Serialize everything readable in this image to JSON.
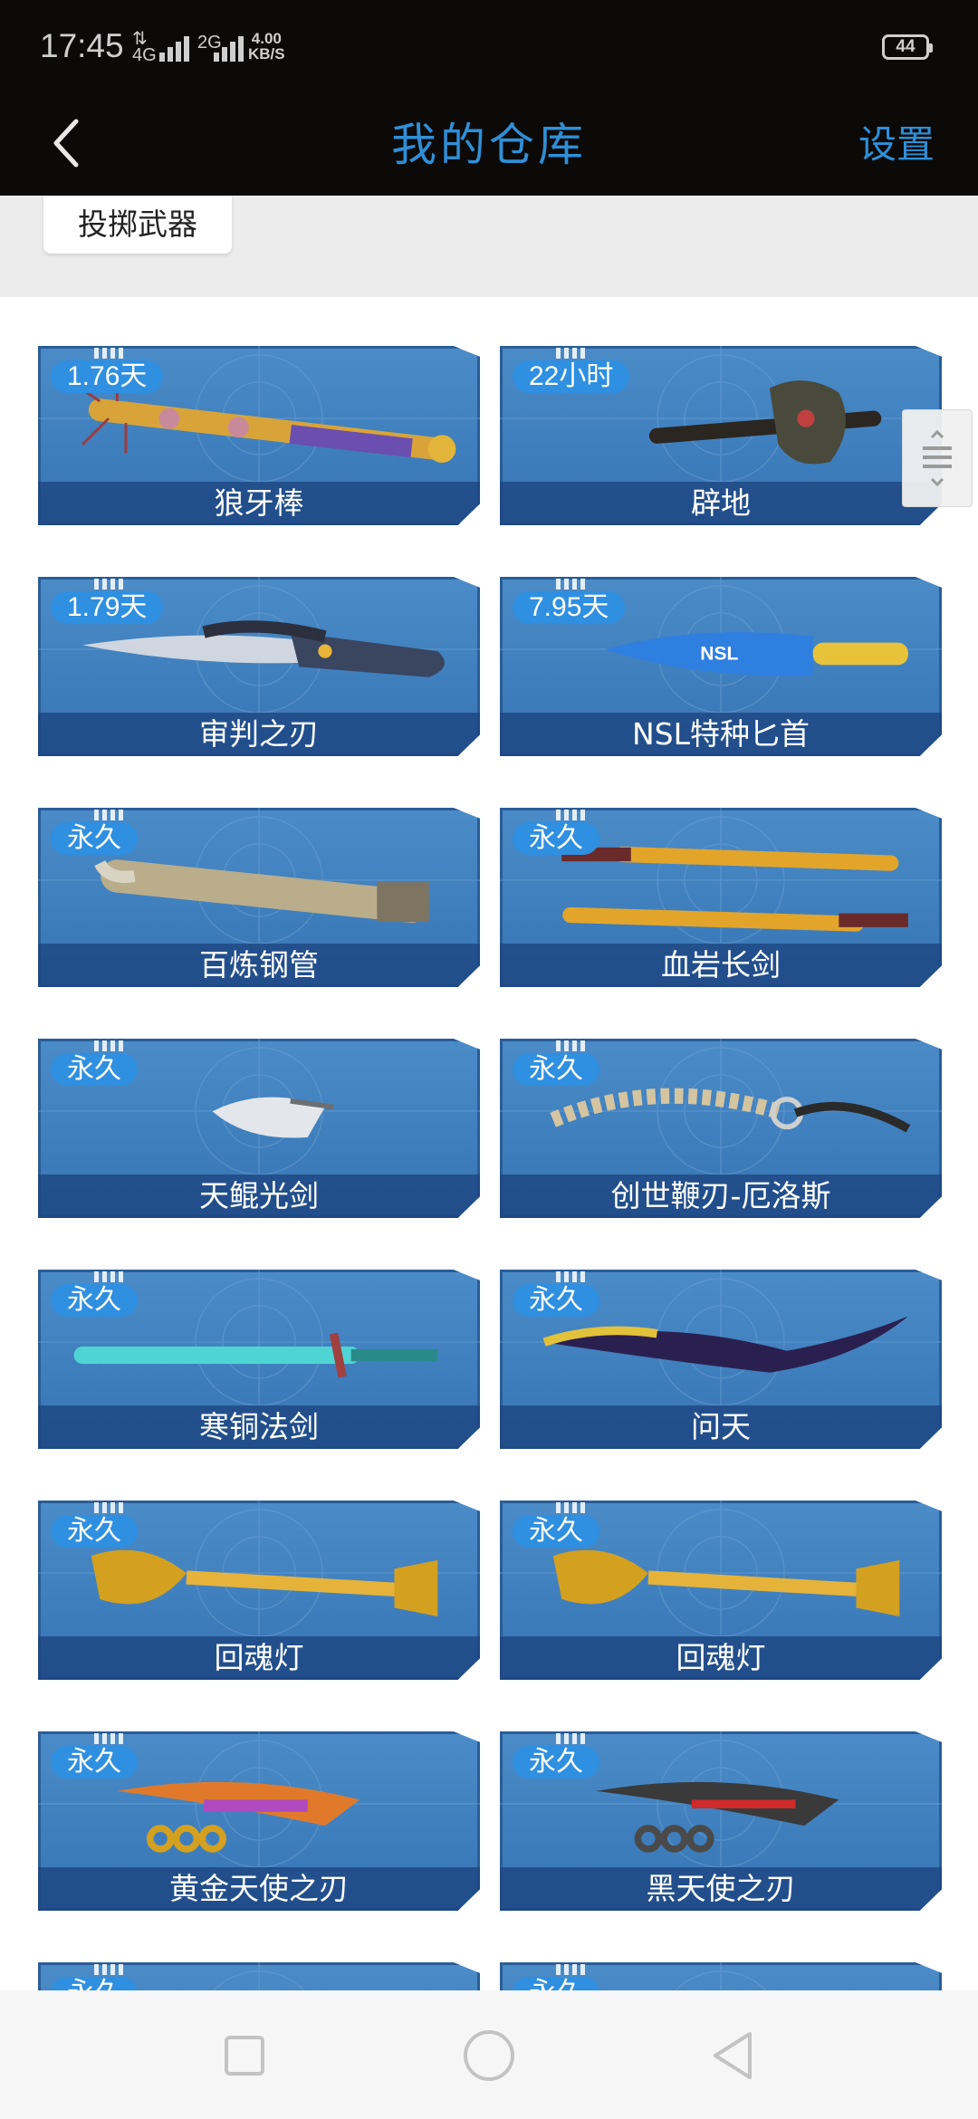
{
  "status_bar": {
    "time": "17:45",
    "net1": "4G",
    "net2": "2G",
    "speed_value": "4.00",
    "speed_unit": "KB/S",
    "battery": "44"
  },
  "header": {
    "title": "我的仓库",
    "settings_label": "设置",
    "back_icon": "chevron-left-icon"
  },
  "filter": {
    "chip_label": "投掷武器"
  },
  "colors": {
    "accent": "#2f8fd8",
    "card": "#3f7fbd",
    "badge": "#2f8fe0"
  },
  "items": [
    {
      "name": "狼牙棒",
      "duration": "1.76天",
      "icon": "spiked-bat-icon"
    },
    {
      "name": "辟地",
      "duration": "22小时",
      "icon": "stone-axe-icon"
    },
    {
      "name": "审判之刃",
      "duration": "1.79天",
      "icon": "curved-blade-icon"
    },
    {
      "name": "NSL特种匕首",
      "duration": "7.95天",
      "icon": "blue-knife-icon"
    },
    {
      "name": "百炼钢管",
      "duration": "永久",
      "icon": "steel-pipe-icon"
    },
    {
      "name": "血岩长剑",
      "duration": "永久",
      "icon": "katana-pair-icon"
    },
    {
      "name": "天鲲光剑",
      "duration": "永久",
      "icon": "light-sword-icon"
    },
    {
      "name": "创世鞭刃-厄洛斯",
      "duration": "永久",
      "icon": "whip-blade-icon"
    },
    {
      "name": "寒铜法剑",
      "duration": "永久",
      "icon": "chain-sword-icon"
    },
    {
      "name": "问天",
      "duration": "永久",
      "icon": "scythe-blade-icon"
    },
    {
      "name": "回魂灯",
      "duration": "永久",
      "icon": "golden-lamp-icon"
    },
    {
      "name": "回魂灯",
      "duration": "永久",
      "icon": "golden-lamp-icon"
    },
    {
      "name": "黄金天使之刃",
      "duration": "永久",
      "icon": "knuckle-blade-gold-icon"
    },
    {
      "name": "黑天使之刃",
      "duration": "永久",
      "icon": "knuckle-blade-black-icon"
    },
    {
      "name": "",
      "duration": "永久",
      "icon": "partial-weapon-icon"
    },
    {
      "name": "",
      "duration": "永久",
      "icon": "partial-weapon-icon"
    }
  ],
  "navbar": {
    "recent_icon": "square-icon",
    "home_icon": "circle-icon",
    "back_icon": "triangle-back-icon"
  }
}
